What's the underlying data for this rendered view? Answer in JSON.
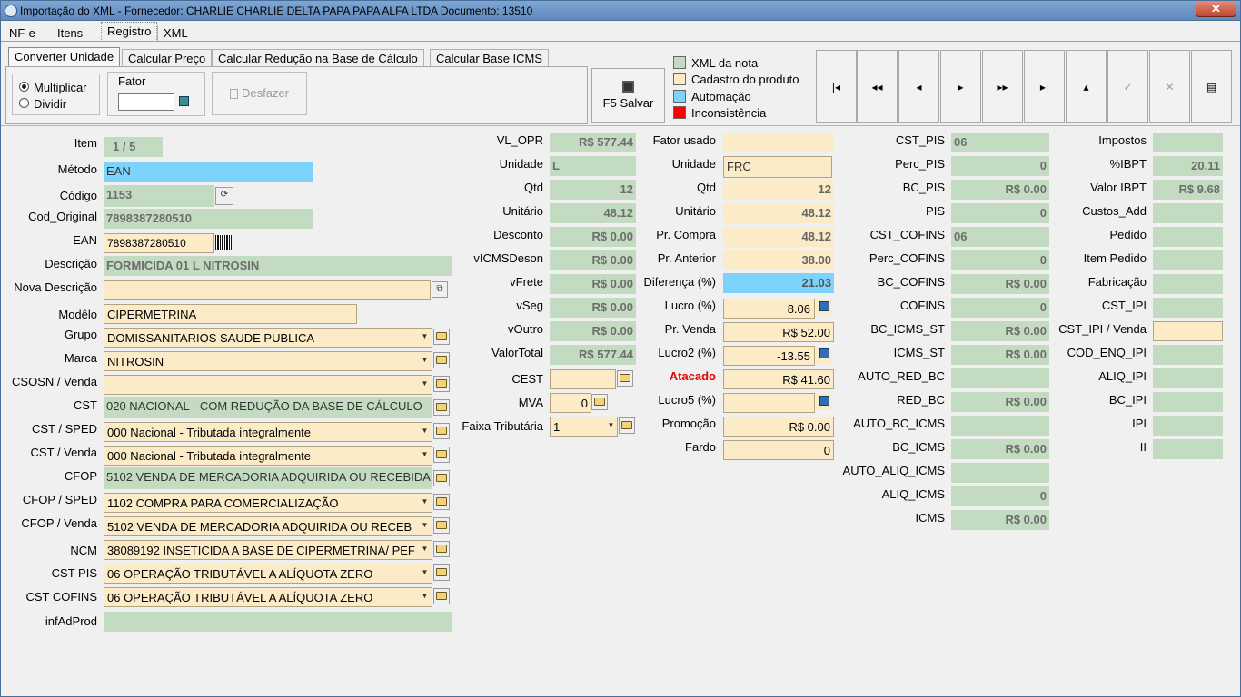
{
  "window": {
    "title": "Importação do XML - Fornecedor: CHARLIE CHARLIE DELTA PAPA PAPA ALFA LTDA Documento: 13510",
    "close": "✕"
  },
  "tabs": [
    "NF-e",
    "Itens",
    "Registro",
    "XML"
  ],
  "subtabs": [
    "Converter Unidade",
    "Calcular Preço",
    "Calcular Redução na Base de Cálculo",
    "Calcular Base ICMS"
  ],
  "convert": {
    "multiplicar": "Multiplicar",
    "dividir": "Dividir",
    "fator_label": "Fator",
    "fator_value": "",
    "desfazer": "Desfazer",
    "salvar": "F5 Salvar"
  },
  "legend": [
    {
      "label": "XML da nota",
      "color": "#c3dcc1"
    },
    {
      "label": "Cadastro do produto",
      "color": "#fbebc6"
    },
    {
      "label": "Automação",
      "color": "#7dd3fb"
    },
    {
      "label": "Inconsistência",
      "color": "#ff0000"
    }
  ],
  "nav": {
    "first": "|◂",
    "prev_page": "◂◂",
    "prev": "◂",
    "next": "▸",
    "next_page": "▸▸",
    "last": "▸|",
    "up": "▴",
    "confirm": "✓",
    "cancel": "✕",
    "form": "▤"
  },
  "left": {
    "item_l": "Item",
    "item_v": "1  /  5",
    "metodo_l": "Método",
    "metodo_v": "EAN",
    "codigo_l": "Código",
    "codigo_v": "1153",
    "codorig_l": "Cod_Original",
    "codorig_v": "7898387280510",
    "ean_l": "EAN",
    "ean_v": "7898387280510",
    "descricao_l": "Descrição",
    "descricao_v": "FORMICIDA 01 L NITROSIN",
    "novadesc_l": "Nova Descrição",
    "novadesc_v": "",
    "modelo_l": "Modêlo",
    "modelo_v": "CIPERMETRINA",
    "grupo_l": "Grupo",
    "grupo_v": "DOMISSANITARIOS SAUDE PUBLICA",
    "marca_l": "Marca",
    "marca_v": "NITROSIN",
    "csosn_l": "CSOSN / Venda",
    "csosn_v": "",
    "cst_l": "CST",
    "cst_v": "020 NACIONAL - COM REDUÇÃO DA BASE DE CÁLCULO",
    "cstsped_l": "CST / SPED",
    "cstsped_v": "000 Nacional - Tributada integralmente",
    "cstvenda_l": "CST / Venda",
    "cstvenda_v": "000 Nacional - Tributada integralmente",
    "cfop_l": "CFOP",
    "cfop_v": "5102 VENDA DE MERCADORIA ADQUIRIDA OU RECEBIDA",
    "cfopsped_l": "CFOP / SPED",
    "cfopsped_v": "1102 COMPRA PARA COMERCIALIZAÇÃO",
    "cfopvenda_l": "CFOP / Venda",
    "cfopvenda_v": "5102 VENDA DE MERCADORIA ADQUIRIDA OU RECEB",
    "ncm_l": "NCM",
    "ncm_v": "38089192 INSETICIDA A BASE DE CIPERMETRINA/ PEF",
    "cstpis_l": "CST PIS",
    "cstpis_v": "06 OPERAÇÃO TRIBUTÁVEL A ALÍQUOTA ZERO",
    "cstcofins_l": "CST COFINS",
    "cstcofins_v": "06 OPERAÇÃO TRIBUTÁVEL A ALÍQUOTA ZERO",
    "infad_l": "infAdProd",
    "infad_v": ""
  },
  "col2": [
    {
      "l": "VL_OPR",
      "v": "R$ 577.44"
    },
    {
      "l": "Unidade",
      "v": "L"
    },
    {
      "l": "Qtd",
      "v": "12"
    },
    {
      "l": "Unitário",
      "v": "48.12"
    },
    {
      "l": "Desconto",
      "v": "R$ 0.00"
    },
    {
      "l": "vICMSDeson",
      "v": "R$ 0.00"
    },
    {
      "l": "vFrete",
      "v": "R$ 0.00"
    },
    {
      "l": "vSeg",
      "v": "R$ 0.00"
    },
    {
      "l": "vOutro",
      "v": "R$ 0.00"
    },
    {
      "l": "ValorTotal",
      "v": "R$ 577.44"
    },
    {
      "l": "CEST",
      "v": ""
    },
    {
      "l": "MVA",
      "v": "0"
    },
    {
      "l": "Faixa Tributária",
      "v": "1"
    }
  ],
  "col3": [
    {
      "l": "Fator usado",
      "v": ""
    },
    {
      "l": "Unidade",
      "v": "FRC"
    },
    {
      "l": "Qtd",
      "v": "12"
    },
    {
      "l": "Unitário",
      "v": "48.12"
    },
    {
      "l": "Pr. Compra",
      "v": "48.12"
    },
    {
      "l": "Pr. Anterior",
      "v": "38.00"
    },
    {
      "l": "Diferença (%)",
      "v": "21.03"
    },
    {
      "l": "Lucro (%)",
      "v": "8.06"
    },
    {
      "l": "Pr. Venda",
      "v": "R$ 52.00"
    },
    {
      "l": "Lucro2 (%)",
      "v": "-13.55"
    },
    {
      "l": "Atacado",
      "v": "R$ 41.60"
    },
    {
      "l": "Lucro5 (%)",
      "v": ""
    },
    {
      "l": "Promoção",
      "v": "R$ 0.00"
    },
    {
      "l": "Fardo",
      "v": "0"
    }
  ],
  "col4": [
    {
      "l": "CST_PIS",
      "v": "06"
    },
    {
      "l": "Perc_PIS",
      "v": "0"
    },
    {
      "l": "BC_PIS",
      "v": "R$ 0.00"
    },
    {
      "l": "PIS",
      "v": "0"
    },
    {
      "l": "CST_COFINS",
      "v": "06"
    },
    {
      "l": "Perc_COFINS",
      "v": "0"
    },
    {
      "l": "BC_COFINS",
      "v": "R$ 0.00"
    },
    {
      "l": "COFINS",
      "v": "0"
    },
    {
      "l": "BC_ICMS_ST",
      "v": "R$ 0.00"
    },
    {
      "l": "ICMS_ST",
      "v": "R$ 0.00"
    },
    {
      "l": "AUTO_RED_BC",
      "v": ""
    },
    {
      "l": "RED_BC",
      "v": "R$ 0.00"
    },
    {
      "l": "AUTO_BC_ICMS",
      "v": ""
    },
    {
      "l": "BC_ICMS",
      "v": "R$ 0.00"
    },
    {
      "l": "AUTO_ALIQ_ICMS",
      "v": ""
    },
    {
      "l": "ALIQ_ICMS",
      "v": "0"
    },
    {
      "l": "ICMS",
      "v": "R$ 0.00"
    }
  ],
  "col5": [
    {
      "l": "Impostos",
      "v": ""
    },
    {
      "l": "%IBPT",
      "v": "20.11"
    },
    {
      "l": "Valor IBPT",
      "v": "R$ 9.68"
    },
    {
      "l": "Custos_Add",
      "v": ""
    },
    {
      "l": "Pedido",
      "v": ""
    },
    {
      "l": "Item Pedido",
      "v": ""
    },
    {
      "l": "Fabricação",
      "v": ""
    },
    {
      "l": "CST_IPI",
      "v": ""
    },
    {
      "l": "CST_IPI / Venda",
      "v": ""
    },
    {
      "l": "COD_ENQ_IPI",
      "v": ""
    },
    {
      "l": "ALIQ_IPI",
      "v": ""
    },
    {
      "l": "BC_IPI",
      "v": ""
    },
    {
      "l": "IPI",
      "v": ""
    },
    {
      "l": "II",
      "v": ""
    }
  ]
}
